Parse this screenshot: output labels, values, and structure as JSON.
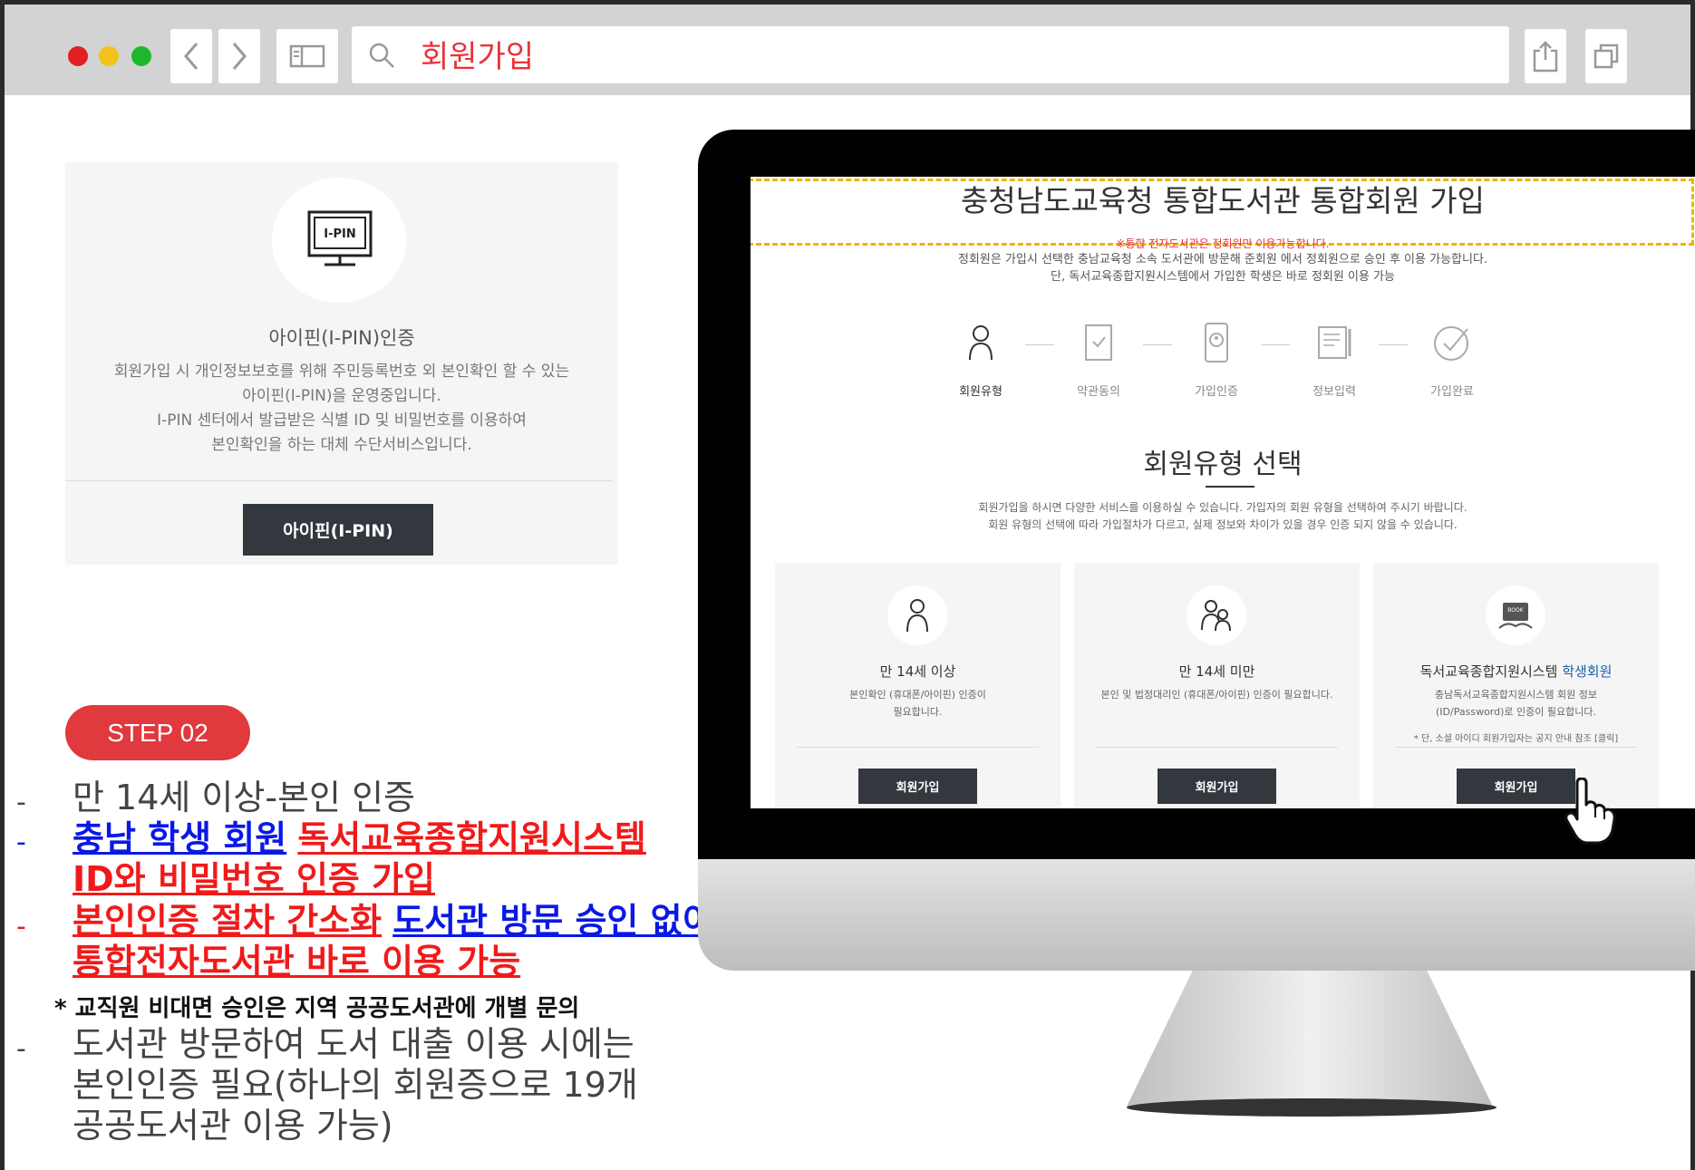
{
  "browser": {
    "address_text": "회원가입",
    "dot_colors": [
      "#e02020",
      "#f2c21b",
      "#1fb82c"
    ],
    "icons": [
      "chevron-left-icon",
      "chevron-right-icon",
      "sidebar-icon",
      "search-icon",
      "share-icon",
      "tabs-icon"
    ]
  },
  "ipin_card": {
    "icon_label": "I-PIN",
    "title": "아이핀(I-PIN)인증",
    "desc_lines": [
      "회원가입 시 개인정보보호를 위해 주민등록번호 외 본인확인 할 수 있는",
      "아이핀(I-PIN)을 운영중입니다.",
      "I-PIN 센터에서 발급받은 식별 ID 및 비밀번호를 이용하여",
      "본인확인을 하는 대체 수단서비스입니다."
    ],
    "button_label": "아이핀(I-PIN)"
  },
  "step_badge": "STEP 02",
  "bullets": {
    "b1": "만 14세 이상-본인 인증",
    "b2_blue": "충남 학생 회원",
    "b2_red": "독서교육종합지원시스템",
    "b2_red2": "ID와 비밀번호 인증 가입",
    "b3_red": "본인인증 절차 간소화",
    "b3_blue": "도서관 방문 승인 없이",
    "b3_red2": "통합전자도서관 바로 이용 가능",
    "note": "* 교직원 비대면 승인은 지역 공공도서관에 개별 문의",
    "b4_line1": "도서관 방문하여 도서 대출 이용 시에는",
    "b4_line2": "본인인증 필요(하나의 회원증으로 19개",
    "b4_line3": "공공도서관 이용 가능)"
  },
  "screen": {
    "title": "충청남도교육청 통합도서관 통합회원 가입",
    "notice": "※통합 전자도서관은 정회원만 이용가능합니다.",
    "desc_line1": "정회원은 가입시 선택한 충남교육청 소속 도서관에 방문해 준회원 에서 정회원으로 승인 후 이용 가능합니다.",
    "desc_line2": "단, 독서교육종합지원시스템에서 가입한 학생은 바로 정회원 이용 가능",
    "steps": [
      "회원유형",
      "약관동의",
      "가입인증",
      "정보입력",
      "가입완료"
    ],
    "select_title": "회원유형 선택",
    "select_desc1": "회원가입을 하시면 다양한 서비스를 이용하실 수 있습니다. 가입자의 회원 유형을 선택하여 주시기 바랍니다.",
    "select_desc2": "회원 유형의 선택에 따라 가입절차가 다르고, 실제 정보와 차이가 있을 경우 인증 되지 않을 수 있습니다.",
    "cards": [
      {
        "title": "만 14세 이상",
        "desc": "본인확인 (휴대폰/아이핀) 인증이 필요합니다.",
        "note": "",
        "button": "회원가입",
        "icon": "person-icon"
      },
      {
        "title": "만 14세 미만",
        "desc": "본인 및 법정대리인 (휴대폰/아이핀) 인증이 필요합니다.",
        "note": "",
        "button": "회원가입",
        "icon": "guardian-icon"
      },
      {
        "title_a": "독서교육종합지원시스템",
        "title_b": "학생회원",
        "desc": "충남독서교육종합지원시스템 회원 정보 (ID/Password)로 인증이 필요합니다.",
        "note": "* 단, 소셜 아이디 회원가입자는 공지 안내 참조 [클릭]",
        "button": "회원가입",
        "icon": "book-icon",
        "book_label": "BOOK"
      }
    ]
  }
}
